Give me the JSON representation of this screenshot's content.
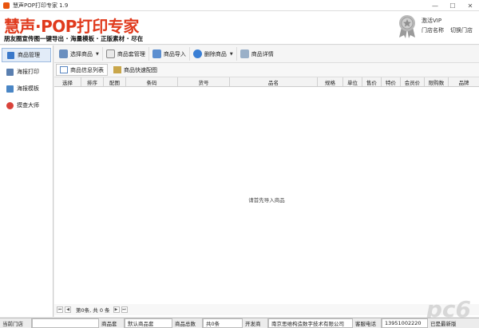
{
  "window": {
    "title": "慧声POP打印专家 1.9",
    "min_label": "—",
    "max_label": "☐",
    "close_label": "✕"
  },
  "banner": {
    "logo": "慧声·POP打印专家",
    "slogan": "朋友圈宣传图一键导出 · 海量模板 · 正版素材 · 尽在",
    "vip_label": "激活VIP",
    "store_name_label": "门店名称",
    "switch_store_label": "切换门店"
  },
  "sidebar": {
    "items": [
      {
        "label": "商品管理",
        "icon": "product-icon",
        "color": "#3a78c9"
      },
      {
        "label": "海报打印",
        "icon": "print-icon",
        "color": "#5a7fb0"
      },
      {
        "label": "海报模板",
        "icon": "template-icon",
        "color": "#4a86c5"
      },
      {
        "label": "摸查大师",
        "icon": "clock-icon",
        "color": "#d9433a"
      }
    ]
  },
  "toolbar": {
    "select_product": "选择商品",
    "product_set": "商品套管理",
    "import_product": "商品导入",
    "delete_product": "删除商品",
    "product_detail": "商品详情"
  },
  "subtabs": {
    "info_list": "商品信息列表",
    "quick_match": "商品快速配图"
  },
  "table": {
    "columns": [
      "选择",
      "排序",
      "配图",
      "条码",
      "货号",
      "品名",
      "规格",
      "单位",
      "售价",
      "特价",
      "会员价",
      "限购数",
      "品牌"
    ],
    "empty_message": "请首先导入商品"
  },
  "pager": {
    "info": "第0条, 共 0 条"
  },
  "watermark": "pc6",
  "statusbar": {
    "current_store_label": "当前门店",
    "current_store_value": "",
    "product_set_label": "商品套",
    "product_set_value": "默认商品套",
    "total_label": "商品总数",
    "total_value": "共0条",
    "developer_label": "开发商",
    "developer_value": "南京思维构造数字技术有限公司",
    "hotline_label": "客服电话",
    "hotline_value": "13951002220",
    "version_value": "已是最新版"
  },
  "colors": {
    "brand_red": "#e03a1d",
    "accent_blue": "#3a78c9"
  }
}
